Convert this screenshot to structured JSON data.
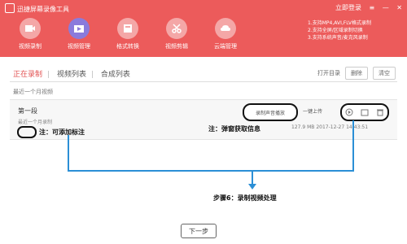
{
  "app": {
    "title": "迅捷屏幕录像工具"
  },
  "window": {
    "login": "立即登录",
    "menu": "≡",
    "minimize": "—",
    "close": "✕"
  },
  "nav": [
    {
      "label": "视频录制",
      "icon": "video-icon"
    },
    {
      "label": "视频管理",
      "icon": "folder-video-icon"
    },
    {
      "label": "格式转换",
      "icon": "convert-icon"
    },
    {
      "label": "视频剪辑",
      "icon": "scissors-icon"
    },
    {
      "label": "云端管理",
      "icon": "cloud-icon"
    }
  ],
  "notice": [
    "1.支持MP4,AVI,FLV格式录制",
    "2.支持全屏/区域录制切换",
    "3.支持系统声音/麦克风录制"
  ],
  "tabs": [
    "正在录制",
    "视频列表",
    "合成列表"
  ],
  "toolbar": {
    "open": "打开目录",
    "btn1": "删除",
    "btn2": "清空"
  },
  "list": {
    "subtitle": "最近一个月视频"
  },
  "record": {
    "name": "第一段",
    "note": "最近一个月录制",
    "sound": "录制声音播放",
    "upload": "一键上传",
    "size": "127.9 MB",
    "time": "2017-12-27 14:43:51"
  },
  "annotations": {
    "note": "注：可添加标注",
    "popup": "注：弹窗获取信息",
    "step": "步骤6：录制视频处理"
  },
  "footer": {
    "next": "下一步"
  },
  "colors": {
    "header": "#ec5b5b",
    "active_nav": "#8a7bdc",
    "connector": "#2b8fd6"
  }
}
